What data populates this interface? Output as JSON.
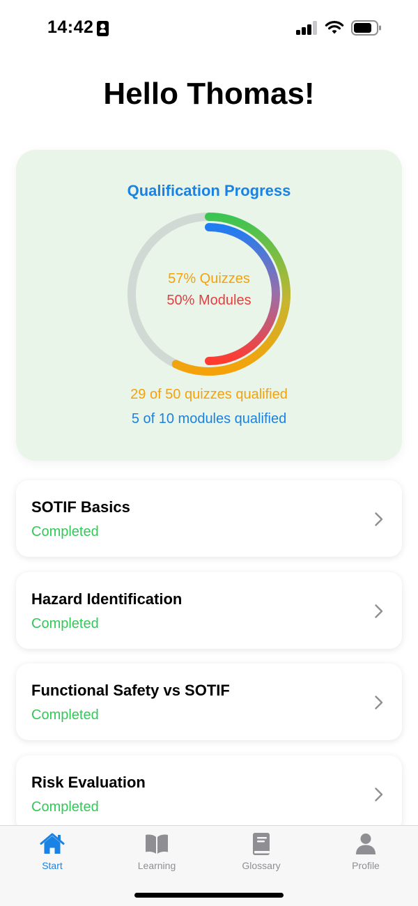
{
  "status_bar": {
    "time": "14:42",
    "icons": [
      "contact-card-icon",
      "cellular-signal-icon",
      "wifi-icon",
      "battery-icon"
    ]
  },
  "greeting": "Hello Thomas!",
  "progress": {
    "title": "Qualification Progress",
    "quiz_percent_label": "57% Quizzes",
    "module_percent_label": "50% Modules",
    "quiz_fraction": 0.57,
    "module_fraction": 0.5,
    "quizzes_summary": "29 of 50 quizzes qualified",
    "modules_summary": "5 of 10 modules qualified",
    "colors": {
      "title": "#1a82e2",
      "quiz": "#f5a20a",
      "module": "#e63d3d",
      "ring_track": "#d1d9d4",
      "ring_green": "#3cc453",
      "ring_blue": "#1f7cf2"
    }
  },
  "modules": [
    {
      "title": "SOTIF Basics",
      "status": "Completed"
    },
    {
      "title": "Hazard Identification",
      "status": "Completed"
    },
    {
      "title": "Functional Safety vs SOTIF",
      "status": "Completed"
    },
    {
      "title": "Risk Evaluation",
      "status": "Completed"
    }
  ],
  "tabs": [
    {
      "label": "Start",
      "icon": "house-icon",
      "active": true
    },
    {
      "label": "Learning",
      "icon": "book-open-icon",
      "active": false
    },
    {
      "label": "Glossary",
      "icon": "book-closed-icon",
      "active": false
    },
    {
      "label": "Profile",
      "icon": "person-icon",
      "active": false
    }
  ],
  "accent_color": "#1a82e2",
  "status_color_completed": "#34c759"
}
